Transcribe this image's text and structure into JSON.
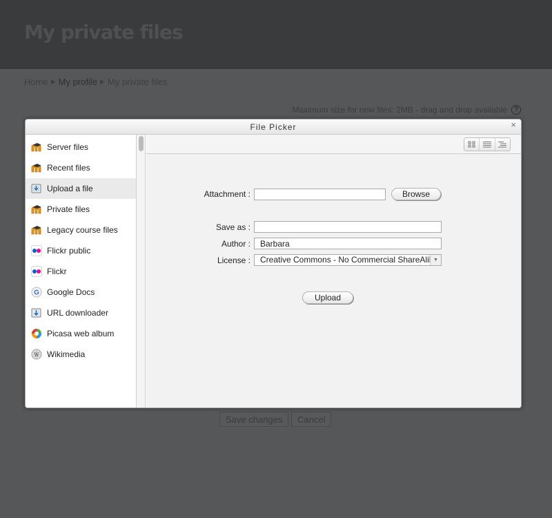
{
  "page": {
    "title": "My private files",
    "breadcrumb": [
      "Home",
      "My profile",
      "My private files"
    ],
    "breadcrumb_sep": "▶",
    "max_size_text": "Maximum size for new files: 2MB - drag and drop available",
    "help_icon": "?",
    "save_label": "Save changes",
    "cancel_label": "Cancel"
  },
  "dialog": {
    "title": "File Picker",
    "close": "×",
    "repositories": [
      {
        "label": "Server files",
        "icon": "moodle-icon",
        "active": false
      },
      {
        "label": "Recent files",
        "icon": "moodle-icon",
        "active": false
      },
      {
        "label": "Upload a file",
        "icon": "upload-icon",
        "active": true
      },
      {
        "label": "Private files",
        "icon": "moodle-icon",
        "active": false
      },
      {
        "label": "Legacy course files",
        "icon": "moodle-icon",
        "active": false
      },
      {
        "label": "Flickr public",
        "icon": "flickr-icon",
        "active": false
      },
      {
        "label": "Flickr",
        "icon": "flickr-icon",
        "active": false
      },
      {
        "label": "Google Docs",
        "icon": "google-icon",
        "active": false
      },
      {
        "label": "URL downloader",
        "icon": "url-download-icon",
        "active": false
      },
      {
        "label": "Picasa web album",
        "icon": "picasa-icon",
        "active": false
      },
      {
        "label": "Wikimedia",
        "icon": "wikimedia-icon",
        "active": false
      }
    ],
    "view_modes": [
      "icons-view-icon",
      "details-view-icon",
      "tree-view-icon"
    ],
    "form": {
      "attachment_label": "Attachment :",
      "attachment_value": "",
      "browse_label": "Browse",
      "saveas_label": "Save as :",
      "saveas_value": "",
      "author_label": "Author :",
      "author_value": "Barbara",
      "license_label": "License :",
      "license_value": "Creative Commons - No Commercial ShareAlike",
      "upload_label": "Upload"
    }
  },
  "colors": {
    "overlay": "#555759",
    "moodle_orange": "#f39c12",
    "flickr_blue": "#0063dc",
    "flickr_pink": "#ff0084"
  }
}
